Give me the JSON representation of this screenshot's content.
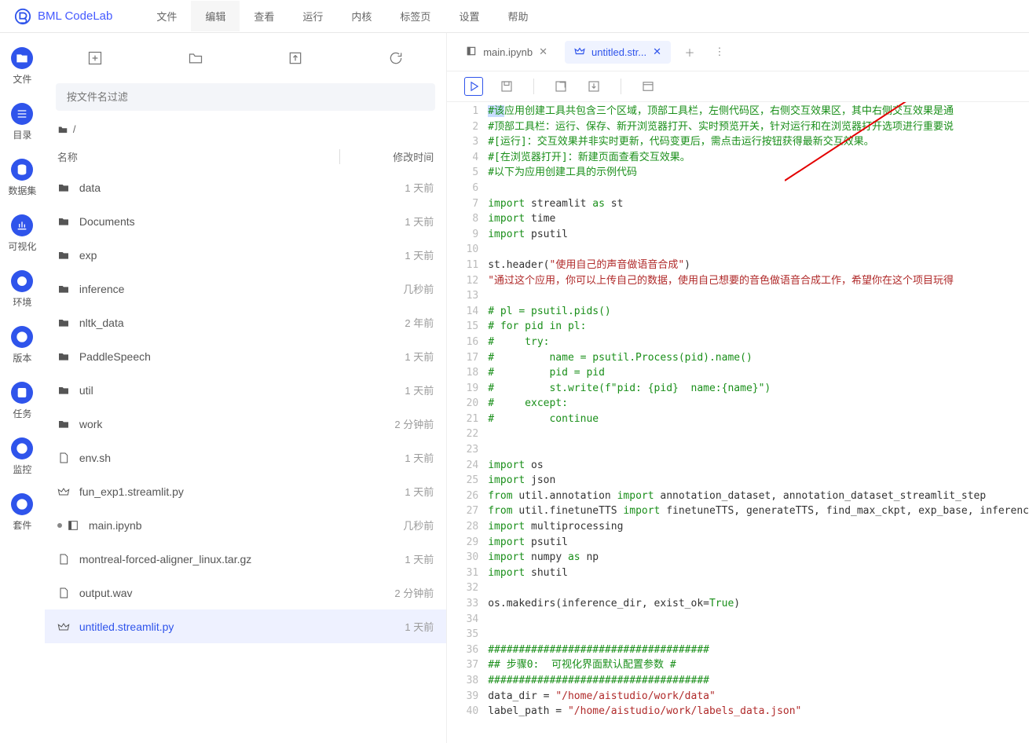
{
  "app": {
    "title": "BML CodeLab"
  },
  "menu": [
    "文件",
    "编辑",
    "查看",
    "运行",
    "内核",
    "标签页",
    "设置",
    "帮助"
  ],
  "menu_active": 1,
  "rail": [
    {
      "label": "文件",
      "icon": "folder"
    },
    {
      "label": "目录",
      "icon": "list"
    },
    {
      "label": "数据集",
      "icon": "db"
    },
    {
      "label": "可视化",
      "icon": "chart"
    },
    {
      "label": "环境",
      "icon": "circle"
    },
    {
      "label": "版本",
      "icon": "clock"
    },
    {
      "label": "任务",
      "icon": "task"
    },
    {
      "label": "监控",
      "icon": "target"
    },
    {
      "label": "套件",
      "icon": "puzzle"
    }
  ],
  "filepanel": {
    "filter_placeholder": "按文件名过滤",
    "crumb": "/",
    "head_name": "名称",
    "head_time": "修改时间",
    "rows": [
      {
        "icon": "folder",
        "name": "data",
        "time": "1 天前"
      },
      {
        "icon": "folder",
        "name": "Documents",
        "time": "1 天前"
      },
      {
        "icon": "folder",
        "name": "exp",
        "time": "1 天前"
      },
      {
        "icon": "folder",
        "name": "inference",
        "time": "几秒前"
      },
      {
        "icon": "folder",
        "name": "nltk_data",
        "time": "2 年前"
      },
      {
        "icon": "folder",
        "name": "PaddleSpeech",
        "time": "1 天前"
      },
      {
        "icon": "folder",
        "name": "util",
        "time": "1 天前"
      },
      {
        "icon": "folder",
        "name": "work",
        "time": "2 分钟前"
      },
      {
        "icon": "file",
        "name": "env.sh",
        "time": "1 天前"
      },
      {
        "icon": "crown",
        "name": "fun_exp1.streamlit.py",
        "time": "1 天前"
      },
      {
        "icon": "nb",
        "name": "main.ipynb",
        "time": "几秒前",
        "dot": true
      },
      {
        "icon": "file",
        "name": "montreal-forced-aligner_linux.tar.gz",
        "time": "1 天前"
      },
      {
        "icon": "file",
        "name": "output.wav",
        "time": "2 分钟前"
      },
      {
        "icon": "crown",
        "name": "untitled.streamlit.py",
        "time": "1 天前",
        "sel": true
      }
    ]
  },
  "tabs": [
    {
      "icon": "nb",
      "label": "main.ipynb",
      "active": false
    },
    {
      "icon": "crown",
      "label": "untitled.str...",
      "active": true
    }
  ],
  "code": [
    {
      "n": 1,
      "seg": [
        {
          "c": "tok-c tok-hl",
          "t": "#该"
        },
        {
          "c": "tok-c",
          "t": "应用创建工具共包含三个区域，顶部工具栏，左侧代码区，右侧交互效果区，其中右侧交互效果是通"
        }
      ]
    },
    {
      "n": 2,
      "seg": [
        {
          "c": "tok-c",
          "t": "#顶部工具栏：运行、保存、新开浏览器打开、实时预览开关，针对运行和在浏览器打开选项进行重要说"
        }
      ]
    },
    {
      "n": 3,
      "seg": [
        {
          "c": "tok-c",
          "t": "#[运行]：交互效果并非实时更新，代码变更后，需点击运行按钮获得最新交互效果。"
        }
      ]
    },
    {
      "n": 4,
      "seg": [
        {
          "c": "tok-c",
          "t": "#[在浏览器打开]：新建页面查看交互效果。"
        }
      ]
    },
    {
      "n": 5,
      "seg": [
        {
          "c": "tok-c",
          "t": "#以下为应用创建工具的示例代码"
        }
      ]
    },
    {
      "n": 6,
      "seg": []
    },
    {
      "n": 7,
      "seg": [
        {
          "c": "tok-k",
          "t": "import"
        },
        {
          "c": "tok-n",
          "t": " streamlit "
        },
        {
          "c": "tok-k",
          "t": "as"
        },
        {
          "c": "tok-n",
          "t": " st"
        }
      ]
    },
    {
      "n": 8,
      "seg": [
        {
          "c": "tok-k",
          "t": "import"
        },
        {
          "c": "tok-n",
          "t": " time"
        }
      ]
    },
    {
      "n": 9,
      "seg": [
        {
          "c": "tok-k",
          "t": "import"
        },
        {
          "c": "tok-n",
          "t": " psutil"
        }
      ]
    },
    {
      "n": 10,
      "seg": []
    },
    {
      "n": 11,
      "seg": [
        {
          "c": "tok-n",
          "t": "st.header("
        },
        {
          "c": "tok-s",
          "t": "\"使用自己的声音做语音合成\""
        },
        {
          "c": "tok-n",
          "t": ")"
        }
      ]
    },
    {
      "n": 12,
      "seg": [
        {
          "c": "tok-s",
          "t": "\"通过这个应用，你可以上传自己的数据，使用自己想要的音色做语音合成工作，希望你在这个项目玩得"
        }
      ]
    },
    {
      "n": 13,
      "seg": []
    },
    {
      "n": 14,
      "seg": [
        {
          "c": "tok-c",
          "t": "# pl = psutil.pids()"
        }
      ]
    },
    {
      "n": 15,
      "seg": [
        {
          "c": "tok-c",
          "t": "# for pid in pl:"
        }
      ]
    },
    {
      "n": 16,
      "seg": [
        {
          "c": "tok-c",
          "t": "#     try:"
        }
      ]
    },
    {
      "n": 17,
      "seg": [
        {
          "c": "tok-c",
          "t": "#         name = psutil.Process(pid).name()"
        }
      ]
    },
    {
      "n": 18,
      "seg": [
        {
          "c": "tok-c",
          "t": "#         pid = pid"
        }
      ]
    },
    {
      "n": 19,
      "seg": [
        {
          "c": "tok-c",
          "t": "#         st.write(f\"pid: {pid}  name:{name}\")"
        }
      ]
    },
    {
      "n": 20,
      "seg": [
        {
          "c": "tok-c",
          "t": "#     except:"
        }
      ]
    },
    {
      "n": 21,
      "seg": [
        {
          "c": "tok-c",
          "t": "#         continue"
        }
      ]
    },
    {
      "n": 22,
      "seg": []
    },
    {
      "n": 23,
      "seg": []
    },
    {
      "n": 24,
      "seg": [
        {
          "c": "tok-k",
          "t": "import"
        },
        {
          "c": "tok-n",
          "t": " os"
        }
      ]
    },
    {
      "n": 25,
      "seg": [
        {
          "c": "tok-k",
          "t": "import"
        },
        {
          "c": "tok-n",
          "t": " json"
        }
      ]
    },
    {
      "n": 26,
      "seg": [
        {
          "c": "tok-k",
          "t": "from"
        },
        {
          "c": "tok-n",
          "t": " util.annotation "
        },
        {
          "c": "tok-k",
          "t": "import"
        },
        {
          "c": "tok-n",
          "t": " annotation_dataset, annotation_dataset_streamlit_step"
        }
      ]
    },
    {
      "n": 27,
      "seg": [
        {
          "c": "tok-k",
          "t": "from"
        },
        {
          "c": "tok-n",
          "t": " util.finetuneTTS "
        },
        {
          "c": "tok-k",
          "t": "import"
        },
        {
          "c": "tok-n",
          "t": " finetuneTTS, generateTTS, find_max_ckpt, exp_base, inferenc"
        }
      ]
    },
    {
      "n": 28,
      "seg": [
        {
          "c": "tok-k",
          "t": "import"
        },
        {
          "c": "tok-n",
          "t": " multiprocessing"
        }
      ]
    },
    {
      "n": 29,
      "seg": [
        {
          "c": "tok-k",
          "t": "import"
        },
        {
          "c": "tok-n",
          "t": " psutil"
        }
      ]
    },
    {
      "n": 30,
      "seg": [
        {
          "c": "tok-k",
          "t": "import"
        },
        {
          "c": "tok-n",
          "t": " numpy "
        },
        {
          "c": "tok-k",
          "t": "as"
        },
        {
          "c": "tok-n",
          "t": " np"
        }
      ]
    },
    {
      "n": 31,
      "seg": [
        {
          "c": "tok-k",
          "t": "import"
        },
        {
          "c": "tok-n",
          "t": " shutil"
        }
      ]
    },
    {
      "n": 32,
      "seg": []
    },
    {
      "n": 33,
      "seg": [
        {
          "c": "tok-n",
          "t": "os.makedirs(inference_dir, exist_ok="
        },
        {
          "c": "tok-k",
          "t": "True"
        },
        {
          "c": "tok-n",
          "t": ")"
        }
      ]
    },
    {
      "n": 34,
      "seg": []
    },
    {
      "n": 35,
      "seg": []
    },
    {
      "n": 36,
      "seg": [
        {
          "c": "tok-c",
          "t": "####################################"
        }
      ]
    },
    {
      "n": 37,
      "seg": [
        {
          "c": "tok-c",
          "t": "## 步骤0:  可视化界面默认配置参数 #"
        }
      ]
    },
    {
      "n": 38,
      "seg": [
        {
          "c": "tok-c",
          "t": "####################################"
        }
      ]
    },
    {
      "n": 39,
      "seg": [
        {
          "c": "tok-n",
          "t": "data_dir = "
        },
        {
          "c": "tok-s",
          "t": "\"/home/aistudio/work/data\""
        }
      ]
    },
    {
      "n": 40,
      "seg": [
        {
          "c": "tok-n",
          "t": "label_path = "
        },
        {
          "c": "tok-s",
          "t": "\"/home/aistudio/work/labels_data.json\""
        }
      ]
    }
  ]
}
